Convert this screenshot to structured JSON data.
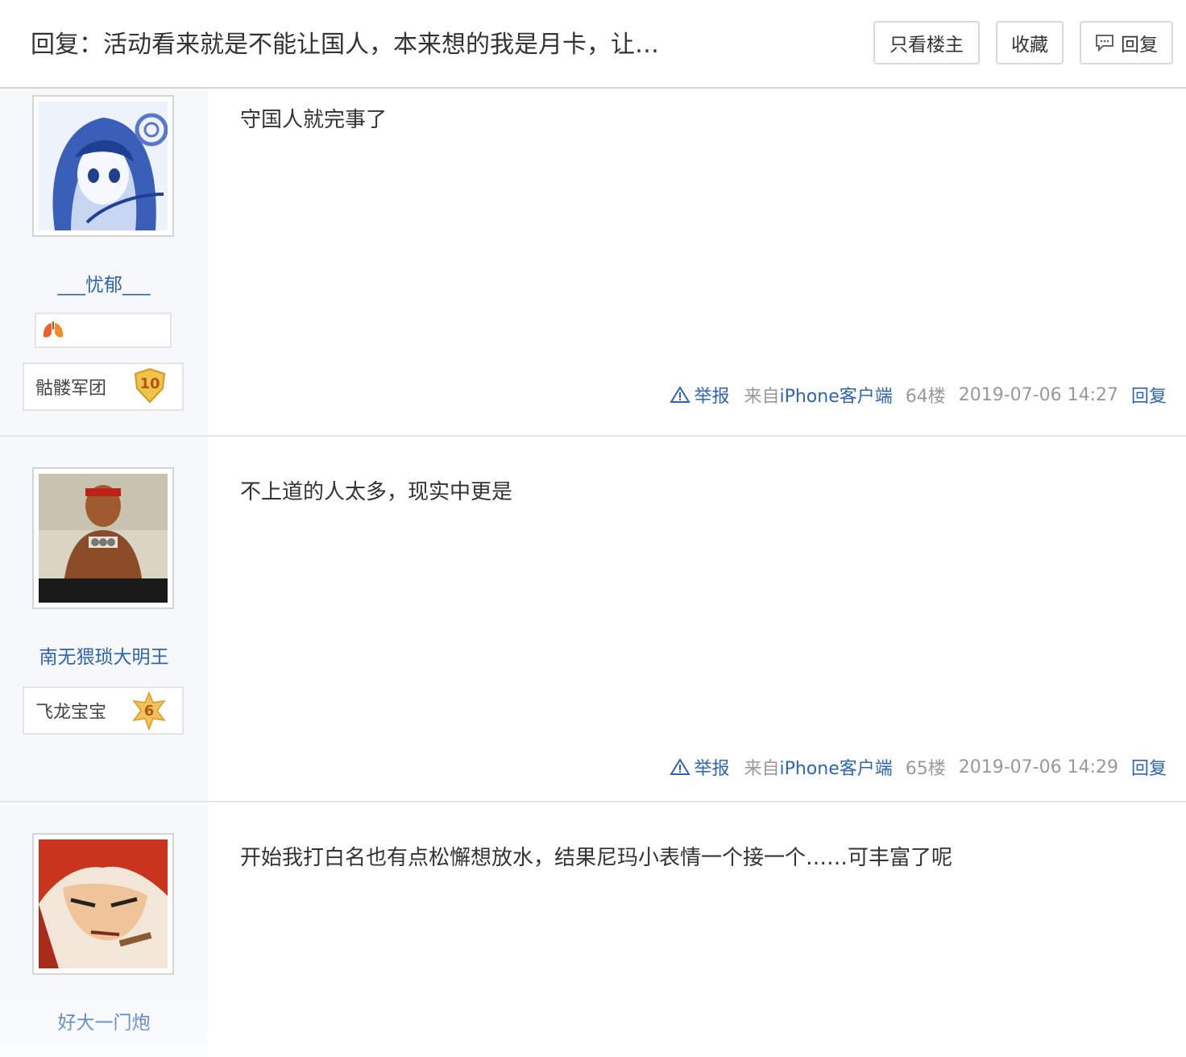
{
  "header": {
    "title": "回复：活动看来就是不能让国人，本来想的我是月卡，让…",
    "only_op_label": "只看楼主",
    "favorite_label": "收藏",
    "reply_label": "回复"
  },
  "posts": [
    {
      "username": "___忧郁___",
      "has_badge_row": true,
      "badge_icon": "orange-lungs-badge",
      "level_name": "骷髅军团",
      "level": "10",
      "content": "守国人就完事了",
      "report_label": "举报",
      "source_prefix": "来自",
      "source_link": "iPhone客户端",
      "floor": "64楼",
      "time": "2019-07-06 14:27",
      "reply_label": "回复",
      "avatar": "anime-girl-avatar-angel-beats"
    },
    {
      "username": "南无猥琐大明王",
      "level_name": "飞龙宝宝",
      "level": "6",
      "content": "不上道的人太多，现实中更是",
      "report_label": "举报",
      "source_prefix": "来自",
      "source_link": "iPhone客户端",
      "floor": "65楼",
      "time": "2019-07-06 14:29",
      "reply_label": "回复",
      "avatar": "fighter-avatar"
    },
    {
      "username": "好大一门炮",
      "content": "开始我打白名也有点松懈想放水，结果尼玛小表情一个接一个……可丰富了呢",
      "avatar": "redhair-avatar"
    }
  ],
  "colors": {
    "link": "#2d64b3",
    "meta": "#999999",
    "sidebar_bg": "#f6f8fb"
  }
}
